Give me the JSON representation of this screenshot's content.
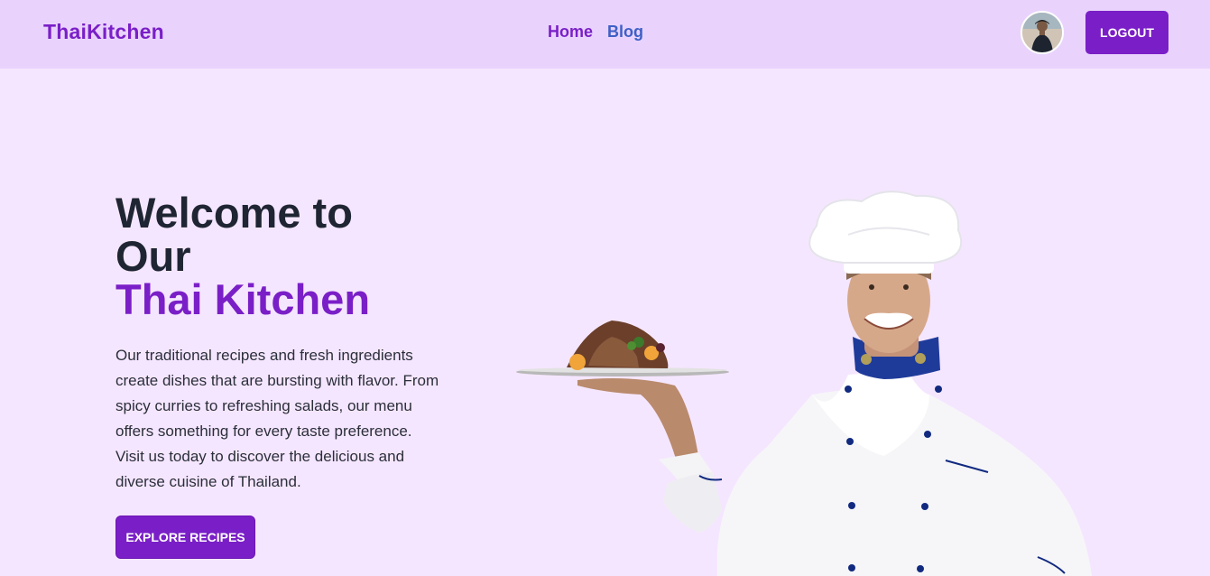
{
  "navbar": {
    "brand": "ThaiKitchen",
    "links": [
      {
        "label": "Home"
      },
      {
        "label": "Blog"
      }
    ],
    "logout_label": "LOGOUT"
  },
  "hero": {
    "title_line1": "Welcome to",
    "title_line2": "Our",
    "title_accent": "Thai Kitchen",
    "description": "Our traditional recipes and fresh ingredients create dishes that are bursting with flavor. From spicy curries to refreshing salads, our menu offers something for every taste preference. Visit us today to discover the delicious and diverse cuisine of Thailand.",
    "cta_label": "EXPLORE RECIPES"
  },
  "colors": {
    "accent": "#7a1fc7",
    "nav_bg": "#e9d3fd",
    "page_bg": "#f5e6ff",
    "link_blue": "#3f5fc6"
  }
}
